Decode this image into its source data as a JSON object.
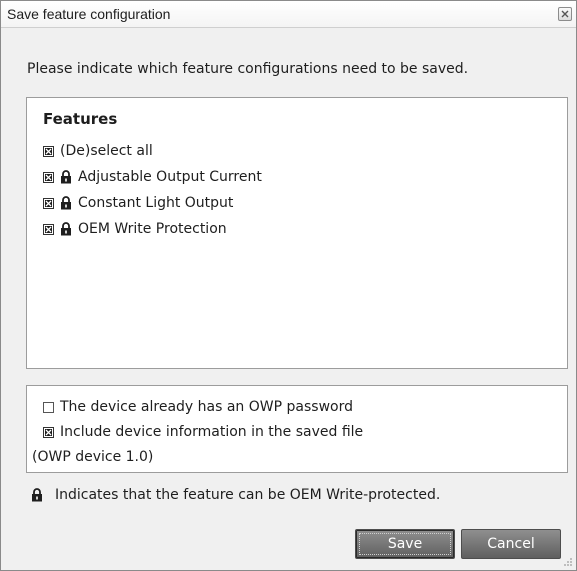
{
  "window": {
    "title": "Save feature configuration"
  },
  "instruction": "Please indicate which feature configurations need to be saved.",
  "features": {
    "heading": "Features",
    "select_all": {
      "label": "(De)select all",
      "checked": true
    },
    "items": [
      {
        "label": "Adjustable Output Current",
        "checked": true,
        "locked": true
      },
      {
        "label": "Constant Light Output",
        "checked": true,
        "locked": true
      },
      {
        "label": "OEM Write Protection",
        "checked": true,
        "locked": true
      }
    ]
  },
  "options": {
    "owp_password": {
      "label": "The device already has an OWP password",
      "checked": false
    },
    "include_device_info": {
      "label": "Include device information in the saved file",
      "checked": true
    },
    "device_note": "(OWP device 1.0)"
  },
  "legend": "Indicates that the feature can be OEM Write-protected.",
  "buttons": {
    "save": "Save",
    "cancel": "Cancel"
  },
  "icons": {
    "lock": "lock-icon",
    "close": "close-icon",
    "checkbox_checked": "checkbox-checked-icon",
    "checkbox_unchecked": "checkbox-unchecked-icon"
  }
}
